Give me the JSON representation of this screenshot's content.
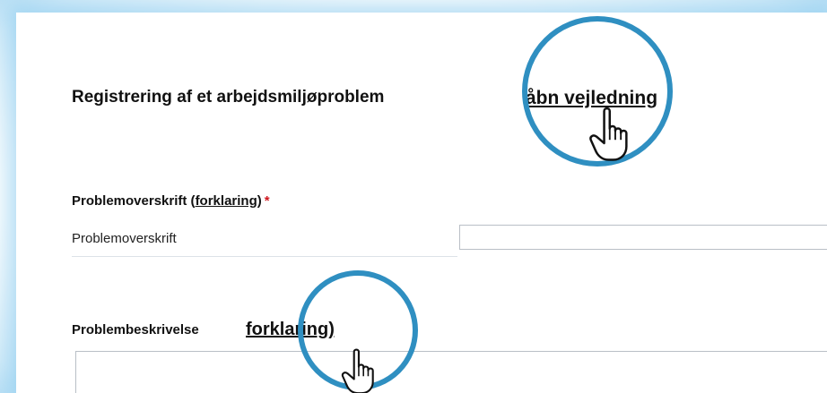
{
  "form": {
    "title": "Registrering af et arbejdsmiljøproblem",
    "title_link": "åbn vejledning",
    "headline_field": {
      "label": "Problemoverskrift",
      "explain_open": " (",
      "explain_link": "forklaring",
      "explain_close": ")",
      "required_marker": "*",
      "row_label": "Problemoverskrift",
      "value": ""
    },
    "description_field": {
      "label": "Problembeskrivelse",
      "explain_link": "forklaring)",
      "value": ""
    }
  },
  "annotations": {
    "ring_color": "#2f8fc1",
    "cursor_icon": "hand-pointer-icon"
  }
}
